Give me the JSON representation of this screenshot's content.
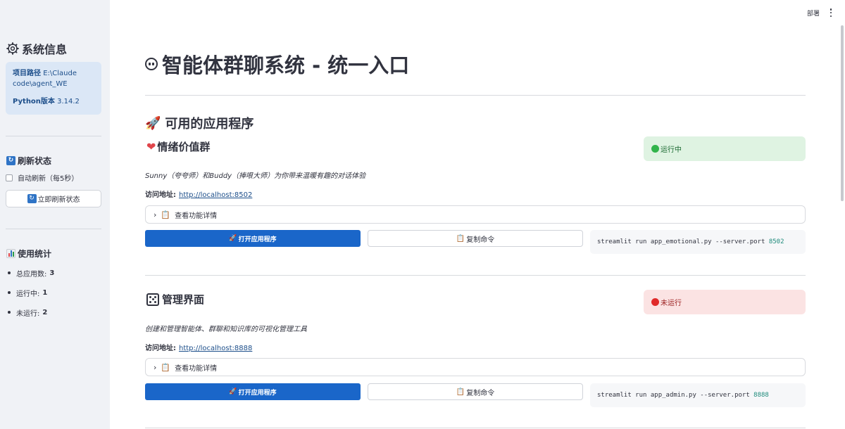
{
  "sidebar": {
    "title": "系统信息",
    "info": {
      "path_label": "项目路径",
      "path_value": "E:\\Claude code\\agent_WE",
      "python_label": "Python版本",
      "python_value": "3.14.2"
    },
    "refresh": {
      "title": "刷新状态",
      "auto_refresh_label": "自动刷新（每5秒）",
      "auto_refresh_checked": false,
      "refresh_button": "立即刷新状态"
    },
    "stats": {
      "title": "使用统计",
      "items": [
        {
          "label": "总应用数:",
          "value": "3"
        },
        {
          "label": "运行中:",
          "value": "1"
        },
        {
          "label": "未运行:",
          "value": "2"
        }
      ]
    }
  },
  "header": {
    "deploy": "部署"
  },
  "main": {
    "title": "智能体群聊系统 - 统一入口",
    "section_title": "可用的应用程序",
    "apps": [
      {
        "name": "情绪价值群",
        "status": "运行中",
        "description": "Sunny（夸夸师）和Buddy（捧哏大师）为你带来温暖有趣的对话体验",
        "url_label": "访问地址:",
        "url": "http://localhost:8502",
        "details_label": "查看功能详情",
        "open_button": "打开应用程序",
        "copy_button": "复制命令",
        "command": "streamlit run app_emotional.py --server.port ",
        "port": "8502"
      },
      {
        "name": "管理界面",
        "status": "未运行",
        "description": "创建和管理智能体、群聊和知识库的可视化管理工具",
        "url_label": "访问地址:",
        "url": "http://localhost:8888",
        "details_label": "查看功能详情",
        "open_button": "打开应用程序",
        "copy_button": "复制命令",
        "command": "streamlit run app_admin.py --server.port ",
        "port": "8888"
      }
    ]
  },
  "colors": {
    "primary_button": "#1a66c9",
    "running_bg": "#dff3e2",
    "stopped_bg": "#fbe3e3",
    "sidebar_bg": "#f0f2f6"
  }
}
